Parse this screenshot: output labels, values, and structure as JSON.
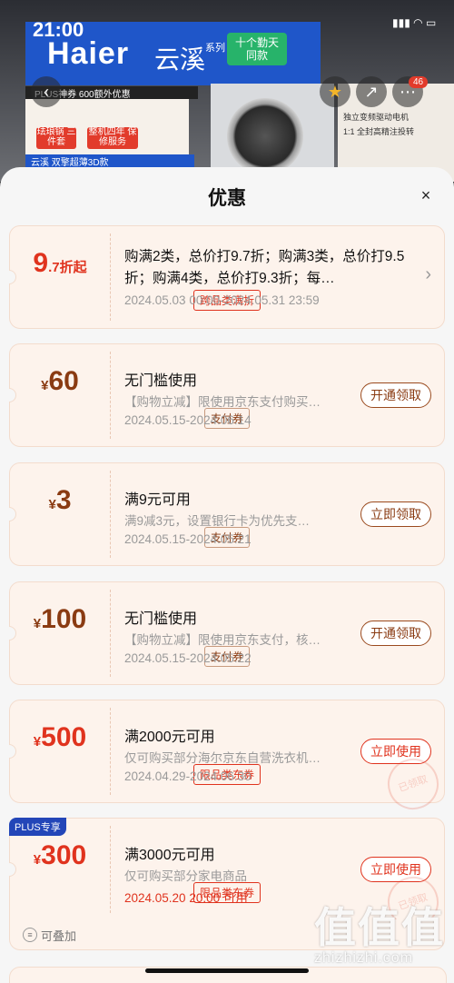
{
  "status": {
    "time": "21:00"
  },
  "banner": {
    "brand": "Haier",
    "series": "云溪",
    "series_suffix": "系列",
    "tag": "十个勤天 同款",
    "plus_text": "PLUS神券 600额外优惠",
    "feature_1": "珐琅锅 三件套",
    "feature_2": "整机四年 保修服务",
    "bottom_text": "云溪 双擎超薄3D款",
    "right_1": "独立变频驱动电机",
    "right_2": "1:1 全封高精注投转",
    "badge_count": "46"
  },
  "sheet": {
    "title": "优惠",
    "close": "×"
  },
  "coupons": [
    {
      "amount_main": "9",
      "amount_suffix": ".7折起",
      "type": "跨品类满折",
      "title": "购满2类，总价打9.7折；购满3类，总价打9.5折；购满4类，总价打9.3折；每…",
      "date": "2024.05.03 00:00-2024.05.31 23:59"
    },
    {
      "currency": "¥",
      "amount": "60",
      "type": "支付券",
      "title": "无门槛使用",
      "desc": "【购物立减】限使用京东支付购买…",
      "date": "2024.05.15-2024.06.14",
      "action": "开通领取"
    },
    {
      "currency": "¥",
      "amount": "3",
      "type": "支付券",
      "title": "满9元可用",
      "desc": "满9减3元，设置银行卡为优先支…",
      "date": "2024.05.15-2024.05.21",
      "action": "立即领取"
    },
    {
      "currency": "¥",
      "amount": "100",
      "type": "支付券",
      "title": "无门槛使用",
      "desc": "【购物立减】限使用京东支付，核…",
      "date": "2024.05.15-2024.05.22",
      "action": "开通领取"
    },
    {
      "currency": "¥",
      "amount": "500",
      "type": "限品类东券",
      "title": "满2000元可用",
      "desc": "仅可购买部分海尔京东自营洗衣机…",
      "date": "2024.04.29-2024.06.30",
      "action": "立即使用",
      "stamp": "已领取"
    },
    {
      "badge": "PLUS专享",
      "currency": "¥",
      "amount": "300",
      "type": "限品类东券",
      "title": "满3000元可用",
      "desc": "仅可购买部分家电商品",
      "date": "2024.05.20 20:00 可用",
      "action": "立即使用",
      "stamp": "已领取"
    }
  ],
  "stack_label": "可叠加",
  "watermark": {
    "big": "值值值",
    "small": "zhizhizhi.com"
  },
  "colors": {
    "red": "#e0331e",
    "brown": "#8a3b12",
    "card_bg": "#fdf3ec"
  }
}
